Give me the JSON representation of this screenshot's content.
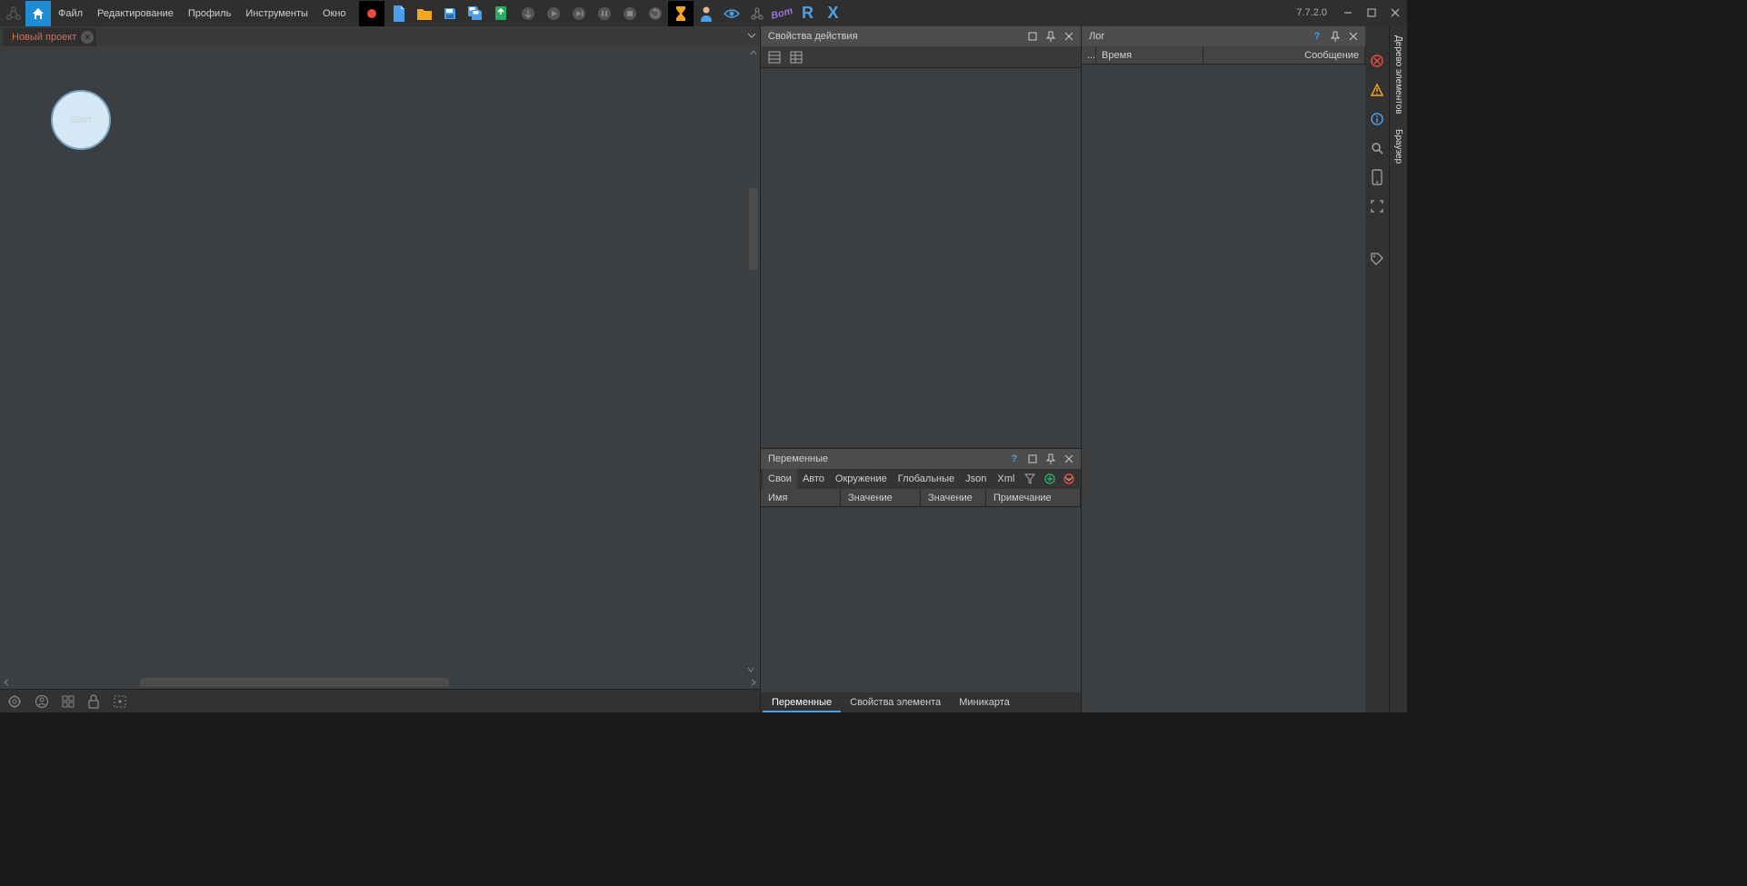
{
  "app": {
    "version": "7.7.2.0"
  },
  "menu": {
    "file": "Файл",
    "edit": "Редактирование",
    "profile": "Профиль",
    "tools": "Инструменты",
    "window": "Окно"
  },
  "tabs": {
    "project": "Новый проект"
  },
  "canvas": {
    "start_label": "Start"
  },
  "panels": {
    "properties": {
      "title": "Свойства действия"
    },
    "variables": {
      "title": "Переменные",
      "tabs": {
        "own": "Свои",
        "auto": "Авто",
        "env": "Окружение",
        "global": "Глобальные",
        "json": "Json",
        "xml": "Xml"
      },
      "cols": {
        "name": "Имя",
        "value": "Значение",
        "value_p": "Значение п...",
        "note": "Примечание"
      }
    },
    "log": {
      "title": "Лог",
      "cols": {
        "ell": "...",
        "time": "Время",
        "msg": "Сообщение"
      }
    }
  },
  "bottom_tabs": {
    "vars": "Переменные",
    "elem_props": "Свойства элемента",
    "minimap": "Миникарта"
  },
  "edge_tabs": {
    "tree": "Дерево элементов",
    "browser": "Браузер"
  }
}
